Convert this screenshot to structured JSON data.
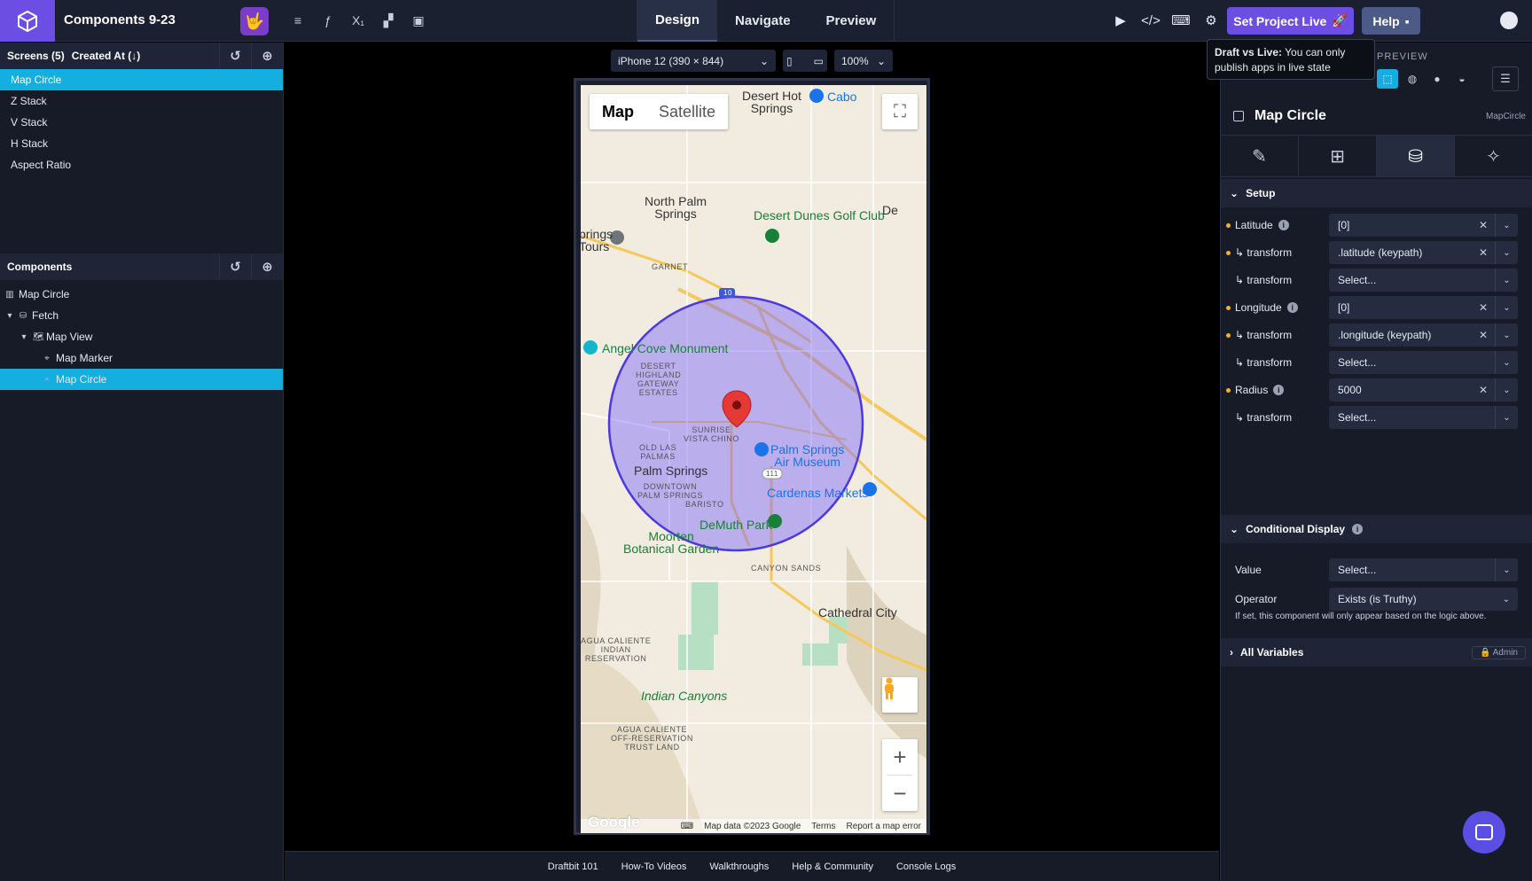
{
  "header": {
    "project_name": "Components 9-23",
    "tabs": [
      "Design",
      "Navigate",
      "Preview"
    ],
    "active_tab": "Design",
    "set_live_label": "Set Project Live",
    "help_label": "Help"
  },
  "tooltip": {
    "title": "Draft vs Live:",
    "text": "You can only publish apps in live state"
  },
  "screens": {
    "header": "Screens (5)",
    "sort": "Created At (↓)",
    "items": [
      "Map Circle",
      "Z Stack",
      "V Stack",
      "H Stack",
      "Aspect Ratio"
    ],
    "selected": "Map Circle"
  },
  "components": {
    "header": "Components",
    "tree": [
      {
        "label": "Map Circle",
        "indent": 0
      },
      {
        "label": "Fetch",
        "indent": 1
      },
      {
        "label": "Map View",
        "indent": 2
      },
      {
        "label": "Map Marker",
        "indent": 3
      },
      {
        "label": "Map Circle",
        "indent": 3
      }
    ]
  },
  "canvas": {
    "device": "iPhone 12 (390 × 844)",
    "zoom": "100%"
  },
  "map": {
    "type_map": "Map",
    "type_satellite": "Satellite",
    "labels": {
      "desert_hot": "Desert Hot\nSprings",
      "cabo": "Cabo",
      "north_palm": "North Palm\nSprings",
      "desert_dunes": "Desert Dunes Golf Club",
      "springs_tours": "prings\nTours",
      "garnet": "GARNET",
      "angel_cove": "Angel Cove Monument",
      "desert_highland": "DESERT\nHIGHLAND\nGATEWAY\nESTATES",
      "sunrise": "SUNRISE\nVISTA CHINO",
      "old_las": "OLD LAS\nPALMAS",
      "palm_springs": "Palm Springs",
      "air_museum": "Palm Springs\nAir Museum",
      "downtown": "DOWNTOWN\nPALM SPRINGS",
      "baristo": "BARISTO",
      "cardenas": "Cardenas Markets",
      "demuth": "DeMuth Park",
      "moorten": "Moorten\nBotanical Garden",
      "canyon_sands": "CANYON SANDS",
      "cathedral": "Cathedral City",
      "agua1": "AGUA CALIENTE\nINDIAN\nRESERVATION",
      "indian_canyons": "Indian Canyons",
      "agua2": "AGUA CALIENTE\nOFF-RESERVATION\nTRUST LAND",
      "de": "De",
      "hw_num": "10",
      "hw_111": "111"
    },
    "attribution": [
      "Map data ©2023 Google",
      "Terms",
      "Report a map error"
    ],
    "google": "Google"
  },
  "footer": [
    "Draftbit 101",
    "How-To Videos",
    "Walkthroughs",
    "Help & Community",
    "Console Logs"
  ],
  "inspector": {
    "preview_label": "PREVIEW",
    "component_title": "Map Circle",
    "component_type": "MapCircle",
    "setup_label": "Setup",
    "props": [
      {
        "label": "Latitude",
        "info": true,
        "dot": true,
        "value": "[0]",
        "clear": true
      },
      {
        "label": "↳ transform",
        "dot": true,
        "value": ".latitude (keypath)",
        "clear": true
      },
      {
        "label": "↳ transform",
        "dot": false,
        "value": "Select...",
        "clear": false
      },
      {
        "label": "Longitude",
        "info": true,
        "dot": true,
        "value": "[0]",
        "clear": true
      },
      {
        "label": "↳ transform",
        "dot": true,
        "value": ".longitude (keypath)",
        "clear": true
      },
      {
        "label": "↳ transform",
        "dot": false,
        "value": "Select...",
        "clear": false
      },
      {
        "label": "Radius",
        "info": true,
        "dot": true,
        "value": "5000",
        "clear": true
      },
      {
        "label": "↳ transform",
        "dot": false,
        "value": "Select...",
        "clear": false
      }
    ],
    "conditional_label": "Conditional Display",
    "value_label": "Value",
    "value_placeholder": "Select...",
    "operator_label": "Operator",
    "operator_value": "Exists (is Truthy)",
    "help_text": "If set, this component will only appear based on the logic above.",
    "all_variables": "All Variables",
    "admin": "Admin"
  }
}
